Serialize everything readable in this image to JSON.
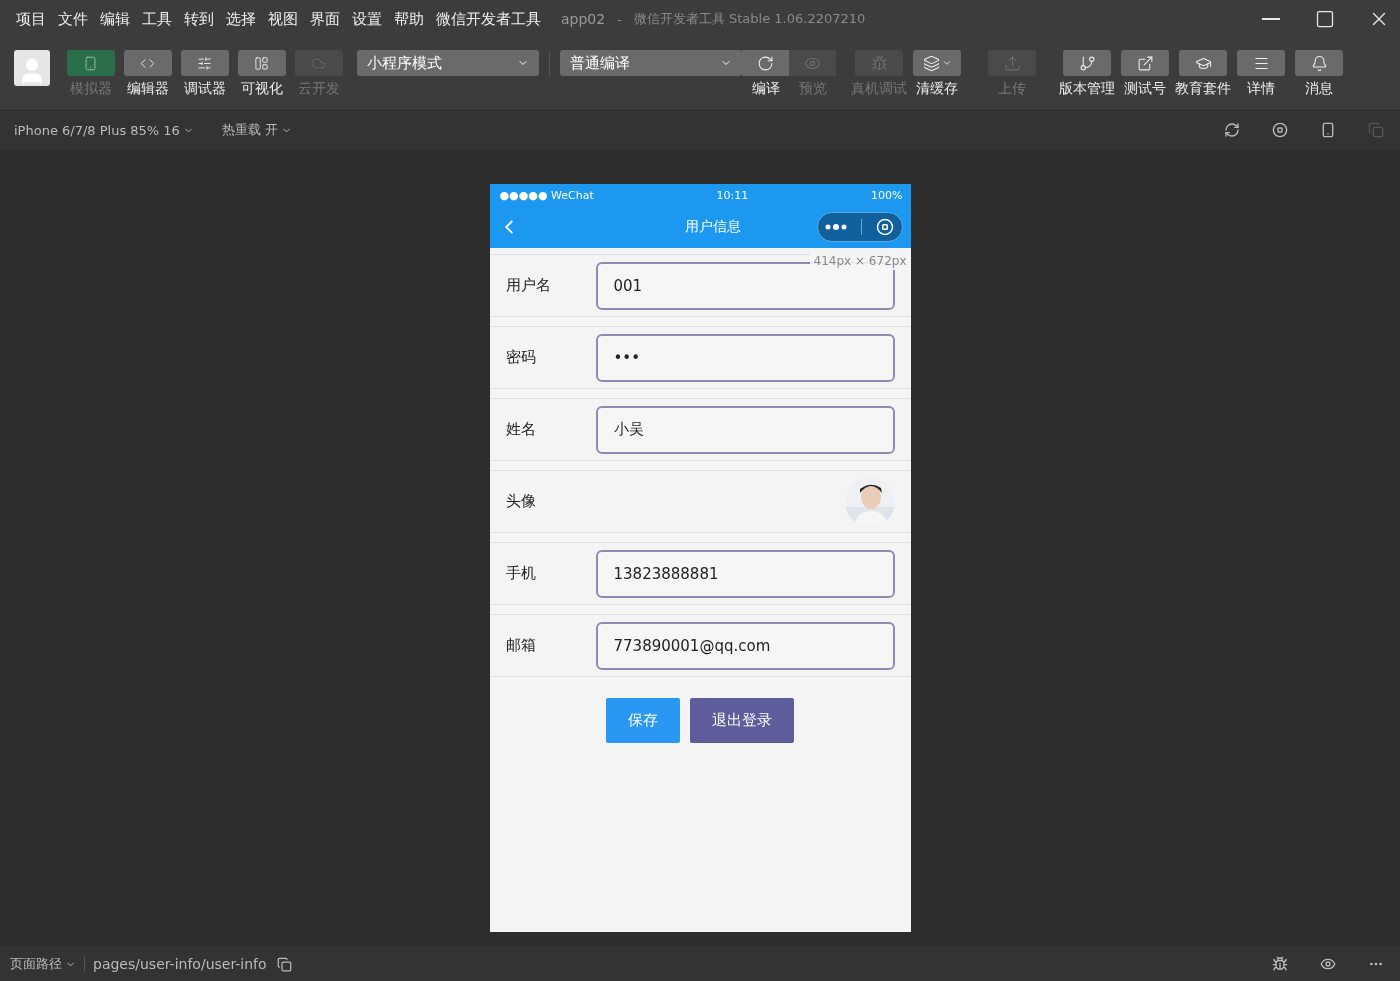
{
  "menu": [
    "项目",
    "文件",
    "编辑",
    "工具",
    "转到",
    "选择",
    "视图",
    "界面",
    "设置",
    "帮助",
    "微信开发者工具"
  ],
  "window": {
    "title": "app02",
    "subtitle": "微信开发者工具 Stable 1.06.2207210",
    "separator": "-"
  },
  "view_tools": [
    {
      "label": "模拟器",
      "selected": true,
      "disabled": false
    },
    {
      "label": "编辑器",
      "selected": false,
      "disabled": false
    },
    {
      "label": "调试器",
      "selected": false,
      "disabled": false
    },
    {
      "label": "可视化",
      "selected": false,
      "disabled": false
    },
    {
      "label": "云开发",
      "selected": false,
      "disabled": true
    }
  ],
  "mode_select": {
    "value": "小程序模式"
  },
  "compile_select": {
    "value": "普通编译"
  },
  "actions": [
    {
      "label": "编译",
      "disabled": false,
      "kind": "joined"
    },
    {
      "label": "预览",
      "disabled": true,
      "kind": "joined"
    },
    {
      "label": "真机调试",
      "disabled": true,
      "kind": "wide"
    },
    {
      "label": "清缓存",
      "disabled": false,
      "kind": "dropdown"
    },
    {
      "label": "上传",
      "disabled": true,
      "kind": "wide"
    },
    {
      "label": "版本管理",
      "disabled": false,
      "kind": "wide"
    },
    {
      "label": "测试号",
      "disabled": false,
      "kind": "wide"
    },
    {
      "label": "教育套件",
      "disabled": false,
      "kind": "wide"
    },
    {
      "label": "详情",
      "disabled": false,
      "kind": "wide"
    },
    {
      "label": "消息",
      "disabled": false,
      "kind": "wide"
    }
  ],
  "sub_toolbar": {
    "device": "iPhone 6/7/8 Plus 85% 16",
    "hot_reload": "热重载 开"
  },
  "phone": {
    "status": {
      "carrier": "●●●●● WeChat",
      "time": "10:11",
      "battery": "100%"
    },
    "nav_title": "用户信息",
    "size_hint": "414px × 672px",
    "rows": [
      {
        "kind": "field",
        "label": "用户名",
        "value": "001"
      },
      {
        "kind": "field",
        "label": "密码",
        "value": "•••"
      },
      {
        "kind": "field",
        "label": "姓名",
        "value": "小吴"
      },
      {
        "kind": "avatar",
        "label": "头像"
      },
      {
        "kind": "field",
        "label": "手机",
        "value": "13823888881"
      },
      {
        "kind": "field",
        "label": "邮箱",
        "value": "773890001@qq.com"
      }
    ],
    "buttons": [
      {
        "label": "保存",
        "kind": "primary"
      },
      {
        "label": "退出登录",
        "kind": "secondary"
      }
    ]
  },
  "status_bar": {
    "path_label": "页面路径",
    "path": "pages/user-info/user-info"
  }
}
